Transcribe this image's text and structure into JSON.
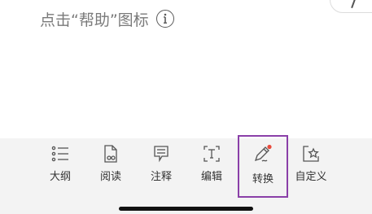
{
  "instruction": {
    "text": "点击“帮助”图标"
  },
  "toolbar": {
    "tabs": [
      {
        "id": "outline",
        "label": "大纲",
        "icon": "outline-list-icon"
      },
      {
        "id": "read",
        "label": "阅读",
        "icon": "read-mode-icon"
      },
      {
        "id": "comment",
        "label": "注释",
        "icon": "comment-icon"
      },
      {
        "id": "edit",
        "label": "编辑",
        "icon": "edit-text-icon"
      },
      {
        "id": "convert",
        "label": "转换",
        "icon": "convert-pen-icon",
        "highlighted": true,
        "badge_color": "#e84a3c"
      },
      {
        "id": "customize",
        "label": "自定义",
        "icon": "customize-star-icon"
      }
    ]
  },
  "colors": {
    "highlight_border": "#8a3fa8",
    "toolbar_bg": "#f3f3f3",
    "badge": "#e84a3c"
  }
}
